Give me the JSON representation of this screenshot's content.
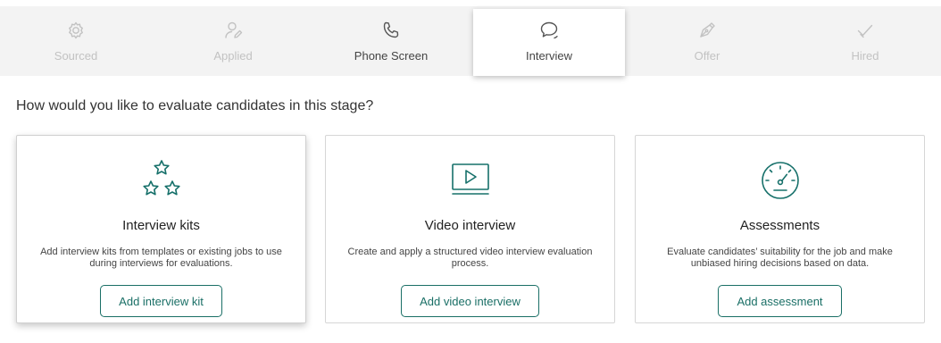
{
  "stages": [
    {
      "label": "Sourced",
      "icon": "gear-icon",
      "state": "disabled"
    },
    {
      "label": "Applied",
      "icon": "user-edit-icon",
      "state": "disabled"
    },
    {
      "label": "Phone Screen",
      "icon": "phone-icon",
      "state": "enabled"
    },
    {
      "label": "Interview",
      "icon": "chat-bubble-icon",
      "state": "active"
    },
    {
      "label": "Offer",
      "icon": "pen-nib-icon",
      "state": "disabled"
    },
    {
      "label": "Hired",
      "icon": "checkmark-icon",
      "state": "disabled"
    }
  ],
  "question": "How would you like to evaluate candidates in this stage?",
  "cards": [
    {
      "title": "Interview kits",
      "icon": "stars-icon",
      "description": "Add interview kits from templates or existing jobs to use during interviews for evaluations.",
      "button": "Add interview kit"
    },
    {
      "title": "Video interview",
      "icon": "video-play-icon",
      "description": "Create and apply a structured video interview evaluation process.",
      "button": "Add video interview"
    },
    {
      "title": "Assessments",
      "icon": "gauge-icon",
      "description": "Evaluate candidates’ suitability for the job and make unbiased hiring decisions based on data.",
      "button": "Add assessment"
    }
  ],
  "colors": {
    "accent": "#16706a",
    "stage_bar": "#f3f3f3",
    "disabled_text": "#c2c2c2"
  }
}
